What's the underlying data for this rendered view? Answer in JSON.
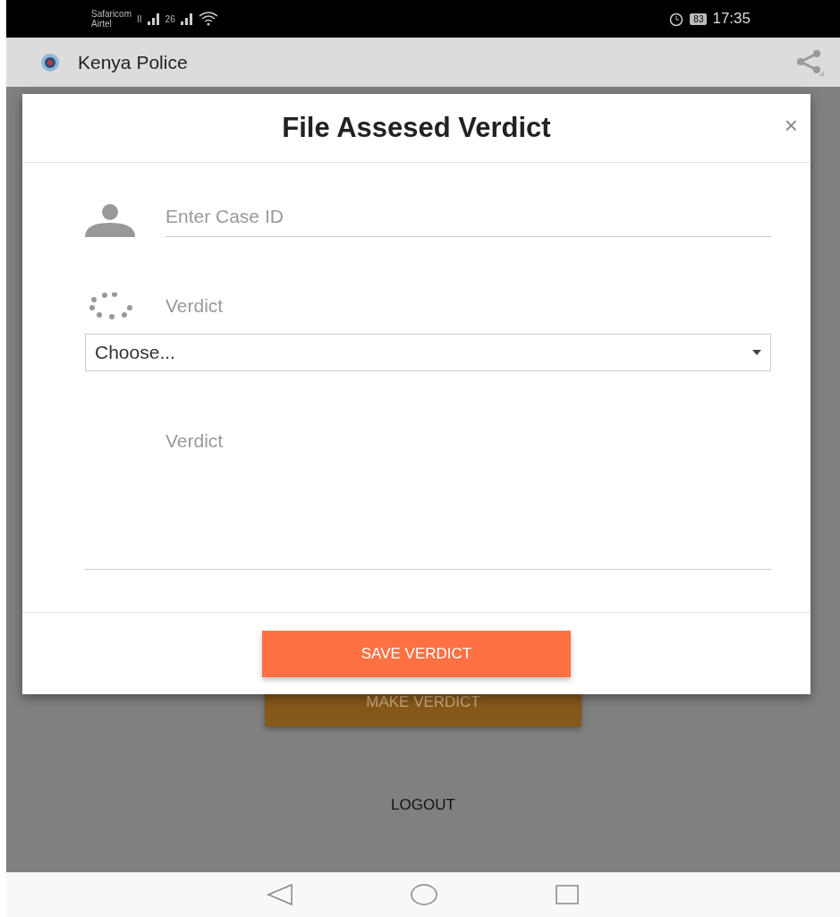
{
  "status_bar": {
    "carrier_1": "Safaricom",
    "carrier_2": "Airtel",
    "sim_1_badge": "II",
    "sim_2_badge": "26",
    "battery": "83",
    "time": "17:35"
  },
  "app_bar": {
    "title": "Kenya Police"
  },
  "background": {
    "primary_button": "MAKE VERDICT",
    "logout": "LOGOUT"
  },
  "modal": {
    "title": "File Assesed Verdict",
    "close": "×",
    "case_id": {
      "placeholder": "Enter Case ID"
    },
    "verdict_label": "Verdict",
    "verdict_select": {
      "value": "Choose..."
    },
    "verdict_text": {
      "placeholder": "Verdict"
    },
    "save_button": "SAVE VERDICT"
  }
}
